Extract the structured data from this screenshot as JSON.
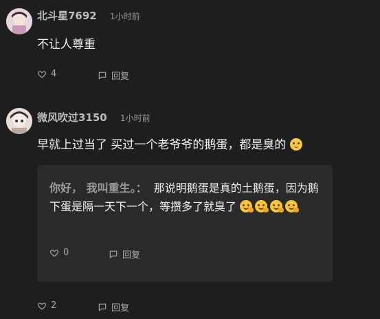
{
  "comments": [
    {
      "username": "北斗星7692",
      "time": "1小时前",
      "text": "不让人尊重",
      "likes": "4",
      "reply_label": "回复"
    },
    {
      "username": "微风吹过3150",
      "time": "1小时前",
      "text": "早就上过当了 买过一个老爷爷的鹅蛋，都是臭的",
      "likes": "2",
      "reply_label": "回复",
      "nested_reply": {
        "username": "你好， 我叫重生。",
        "separator": "：",
        "text": "那说明鹅蛋是真的土鹅蛋，因为鹅下蛋是隔一天下一个，等攒多了就臭了",
        "likes": "0",
        "reply_label": "回复"
      }
    }
  ],
  "icons": {
    "heart": "heart-icon",
    "reply": "comment-icon",
    "eyeroll": "eye-roll-emoji",
    "shush": "shushing-face-emoji"
  }
}
